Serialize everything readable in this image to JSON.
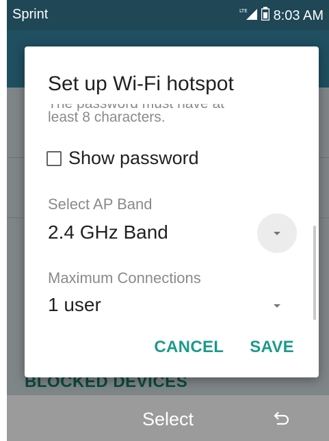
{
  "status_bar": {
    "carrier": "Sprint",
    "network_badge": "LTE",
    "time": "8:03 AM",
    "signal_icon": "signal-icon",
    "battery_icon": "battery-icon"
  },
  "background": {
    "blocked_devices_label": "BLOCKED DEVICES"
  },
  "dialog": {
    "title": "Set up Wi-Fi hotspot",
    "partial_text": "The password must have at",
    "helper_text": "least 8 characters.",
    "show_password_label": "Show password",
    "show_password_checked": false,
    "ap_band": {
      "label": "Select AP Band",
      "value": "2.4 GHz Band"
    },
    "max_connections": {
      "label": "Maximum Connections",
      "value": "1 user"
    },
    "cancel_label": "CANCEL",
    "save_label": "SAVE"
  },
  "bottom_bar": {
    "select_label": "Select",
    "back_icon": "back-icon"
  },
  "colors": {
    "accent": "#1b9a8a",
    "status_bar": "#1f4756",
    "bottom_bar": "#9b9b9b"
  }
}
